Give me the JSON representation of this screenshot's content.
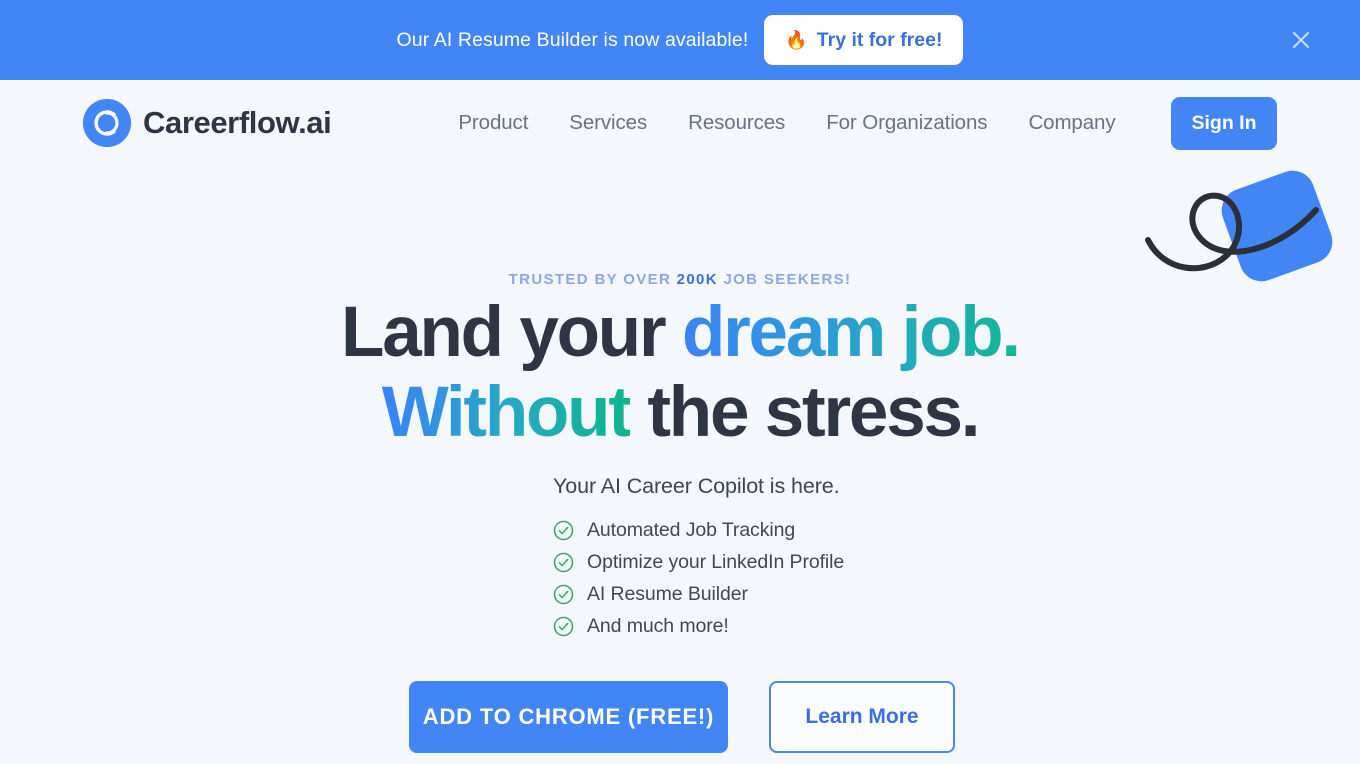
{
  "banner": {
    "message": "Our AI Resume Builder is now available!",
    "cta_label": "Try it for free!",
    "flame_icon": "fire-icon",
    "close_icon": "close-icon",
    "background_color": "#4285f4",
    "cta_text_color": "#3b6fe0"
  },
  "header": {
    "brand_name": "Careerflow.ai",
    "brand_icon": "careerflow-logo-icon",
    "nav": [
      {
        "label": "Product"
      },
      {
        "label": "Services"
      },
      {
        "label": "Resources"
      },
      {
        "label": "For Organizations"
      },
      {
        "label": "Company"
      }
    ],
    "signin_label": "Sign In",
    "accent_color": "#4285f4"
  },
  "hero": {
    "eyebrow_prefix": "TRUSTED BY OVER ",
    "eyebrow_highlight": "200K",
    "eyebrow_suffix": " JOB SEEKERS!",
    "headline_line1_plain": "Land your ",
    "headline_line1_gradient": "dream job.",
    "headline_line2_gradient": "Without",
    "headline_line2_plain": " the stress.",
    "subheadline": "Your AI Career Copilot is here.",
    "features": [
      {
        "label": "Automated Job Tracking",
        "icon": "check-circle-icon"
      },
      {
        "label": "Optimize your LinkedIn Profile",
        "icon": "check-circle-icon"
      },
      {
        "label": "AI Resume Builder",
        "icon": "check-circle-icon"
      },
      {
        "label": "And much more!",
        "icon": "check-circle-icon"
      }
    ],
    "primary_cta": "ADD TO CHROME  (FREE!)",
    "secondary_cta": "Learn More",
    "gradient_start_color": "#3b82f6",
    "gradient_end_color": "#14b894",
    "check_color": "#34a853",
    "decoration": "swirl-and-blue-shape-graphic"
  }
}
